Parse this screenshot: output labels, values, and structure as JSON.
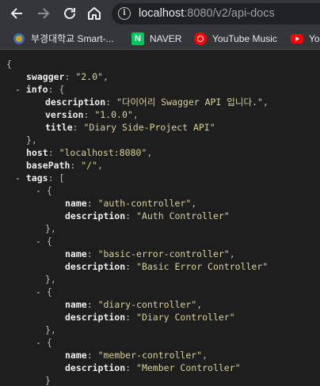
{
  "browser": {
    "url_host": "localhost",
    "url_path": ":8080/v2/api-docs",
    "bookmarks": [
      {
        "label": "부경대학교 Smart-...",
        "icon": "university-icon"
      },
      {
        "label": "NAVER",
        "icon": "naver-icon",
        "icon_text": "N"
      },
      {
        "label": "YouTube Music",
        "icon": "youtube-music-icon"
      },
      {
        "label": "Yo",
        "icon": "youtube-icon"
      }
    ]
  },
  "json": {
    "open_brace": "{",
    "swagger_key": "swagger",
    "swagger_value": "\"2.0\"",
    "info_key": "info",
    "info_open": "{",
    "description_key": "description",
    "info_description": "\"다이어리 Swagger API 입니다.\"",
    "version_key": "version",
    "info_version": "\"1.0.0\"",
    "title_key": "title",
    "info_title": "\"Diary Side-Project API\"",
    "info_close": "},",
    "host_key": "host",
    "host_value": "\"localhost:8080\"",
    "basepath_key": "basePath",
    "basepath_value": "\"/\"",
    "tags_key": "tags",
    "tags_open": "[",
    "name_key": "name",
    "tags": [
      {
        "name": "\"auth-controller\"",
        "description": "\"Auth Controller\""
      },
      {
        "name": "\"basic-error-controller\"",
        "description": "\"Basic Error Controller\""
      },
      {
        "name": "\"diary-controller\"",
        "description": "\"Diary Controller\""
      },
      {
        "name": "\"member-controller\"",
        "description": "\"Member Controller\""
      }
    ],
    "toggle": "-",
    "obj_open": "{",
    "obj_close": "},",
    "obj_close_last": "}"
  }
}
